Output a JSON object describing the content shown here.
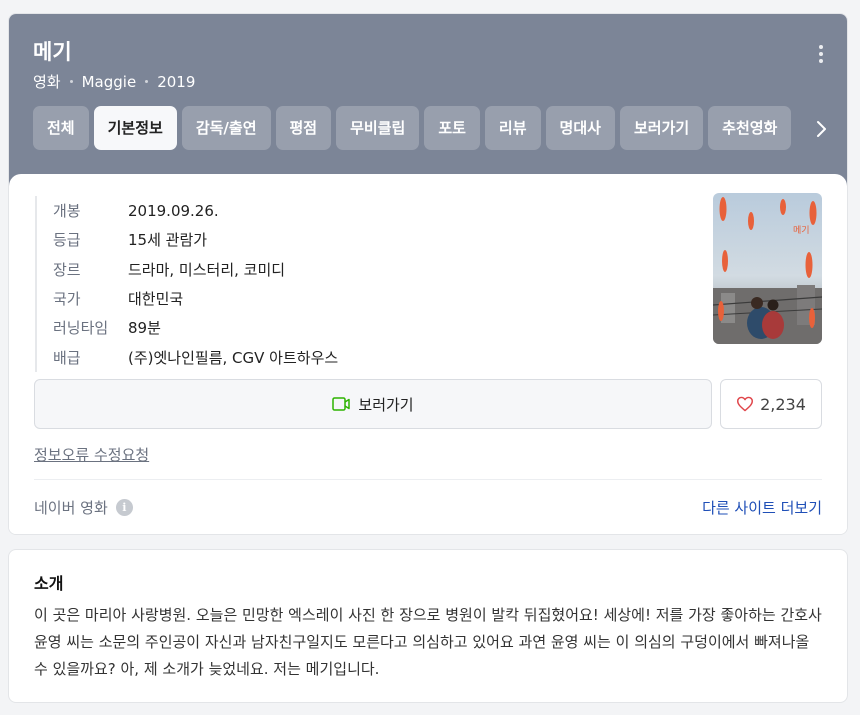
{
  "movie": {
    "title": "메기",
    "type": "영화",
    "english_title": "Maggie",
    "year": "2019"
  },
  "tabs": [
    {
      "label": "전체"
    },
    {
      "label": "기본정보"
    },
    {
      "label": "감독/출연"
    },
    {
      "label": "평점"
    },
    {
      "label": "무비클립"
    },
    {
      "label": "포토"
    },
    {
      "label": "리뷰"
    },
    {
      "label": "명대사"
    },
    {
      "label": "보러가기"
    },
    {
      "label": "추천영화"
    }
  ],
  "active_tab": "기본정보",
  "info": [
    {
      "key": "개봉",
      "value": "2019.09.26."
    },
    {
      "key": "등급",
      "value": "15세 관람가"
    },
    {
      "key": "장르",
      "value": "드라마, 미스터리, 코미디"
    },
    {
      "key": "국가",
      "value": "대한민국"
    },
    {
      "key": "러닝타임",
      "value": "89분"
    },
    {
      "key": "배급",
      "value": "(주)엣나인필름, CGV 아트하우스"
    }
  ],
  "actions": {
    "watch_label": "보러가기",
    "like_count": "2,234"
  },
  "report_label": "정보오류 수정요청",
  "source_label": "네이버 영화",
  "other_sites_label": "다른 사이트 더보기",
  "intro": {
    "heading": "소개",
    "text": "이 곳은 마리아 사랑병원. 오늘은 민망한 엑스레이 사진 한 장으로 병원이 발칵 뒤집혔어요! 세상에! 저를 가장 좋아하는 간호사 윤영 씨는 소문의 주인공이 자신과 남자친구일지도 모른다고 의심하고 있어요 과연 윤영 씨는 이 의심의 구덩이에서 빠져나올 수 있을까요? 아, 제 소개가 늦었네요. 저는 메기입니다."
  },
  "colors": {
    "hero_bg": "#7c8597",
    "link_blue": "#1f4fb7",
    "watch_icon_green": "#2db400",
    "heart_red": "#e0464b"
  },
  "icons": {
    "more": "more-vertical-icon",
    "next": "chevron-right-icon",
    "watch": "play-screen-icon",
    "like": "heart-icon",
    "info": "info-icon"
  }
}
